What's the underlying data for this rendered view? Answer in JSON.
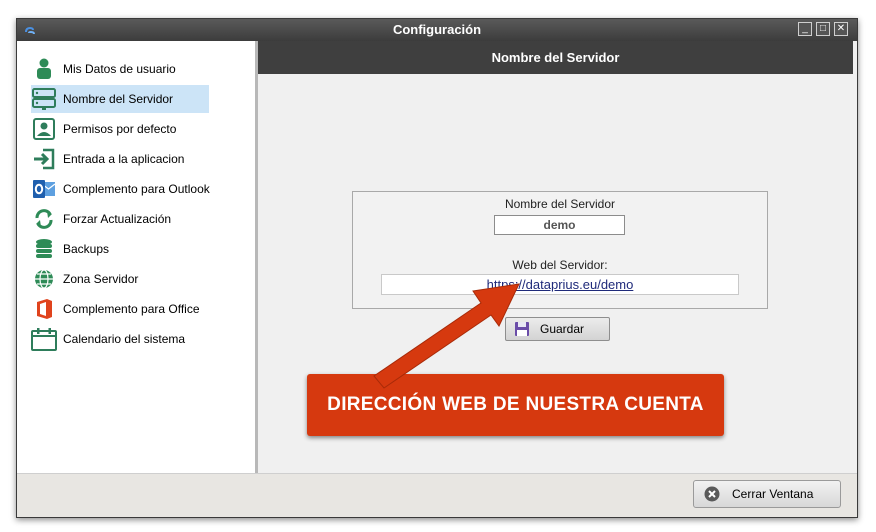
{
  "window": {
    "title": "Configuración"
  },
  "sidebar": {
    "items": [
      {
        "label": "Mis Datos de usuario",
        "icon": "user-icon"
      },
      {
        "label": "Nombre del Servidor",
        "icon": "server-icon",
        "selected": true
      },
      {
        "label": "Permisos por defecto",
        "icon": "user-badge-icon"
      },
      {
        "label": "Entrada a la aplicacion",
        "icon": "sign-in-icon"
      },
      {
        "label": "Complemento para Outlook",
        "icon": "outlook-icon"
      },
      {
        "label": "Forzar Actualización",
        "icon": "refresh-icon"
      },
      {
        "label": "Backups",
        "icon": "database-icon"
      },
      {
        "label": "Zona Servidor",
        "icon": "globe-icon"
      },
      {
        "label": "Complemento para Office",
        "icon": "office-icon"
      },
      {
        "label": "Calendario del sistema",
        "icon": "calendar-icon"
      }
    ]
  },
  "main": {
    "header": "Nombre del Servidor",
    "server_name_label": "Nombre del Servidor",
    "server_name_value": "demo",
    "web_label": "Web del Servidor:",
    "web_value": "https://dataprius.eu/demo",
    "save_label": "Guardar"
  },
  "annotation": {
    "text": "DIRECCIÓN WEB DE NUESTRA CUENTA",
    "color": "#d6390f"
  },
  "footer": {
    "close_label": "Cerrar Ventana"
  },
  "colors": {
    "accent_green": "#2e8b57",
    "header_dark": "#3f3f3f",
    "selection": "#cce4f7"
  }
}
